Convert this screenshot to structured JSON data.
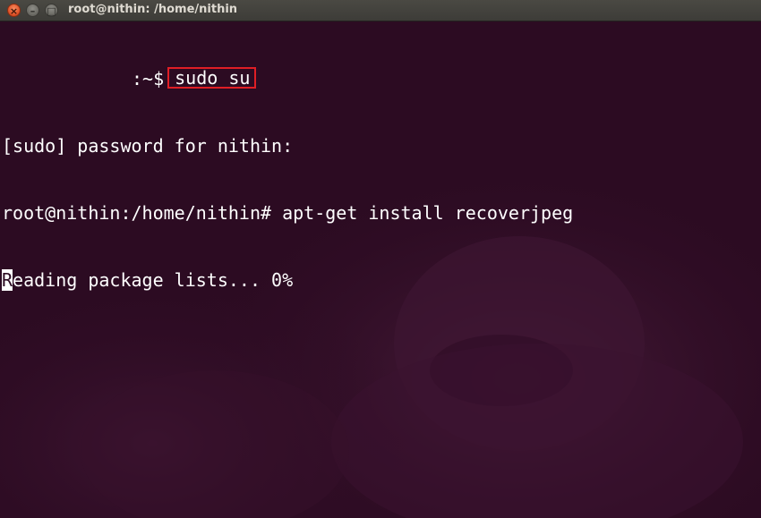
{
  "window": {
    "title": "root@nithin: /home/nithin",
    "close_glyph": "×",
    "minimize_glyph": "–",
    "maximize_glyph": "□"
  },
  "terminal": {
    "line1": {
      "prompt_suffix": ":~$",
      "command": "sudo su"
    },
    "line2": "[sudo] password for nithin:",
    "line3": "root@nithin:/home/nithin# apt-get install recoverjpeg",
    "line4": {
      "cursor_char": "R",
      "rest": "eading package lists... 0%"
    }
  },
  "colors": {
    "background": "#2c0b22",
    "text": "#ffffff",
    "highlight_box": "#e01e25",
    "titlebar": "#3d3c38"
  }
}
